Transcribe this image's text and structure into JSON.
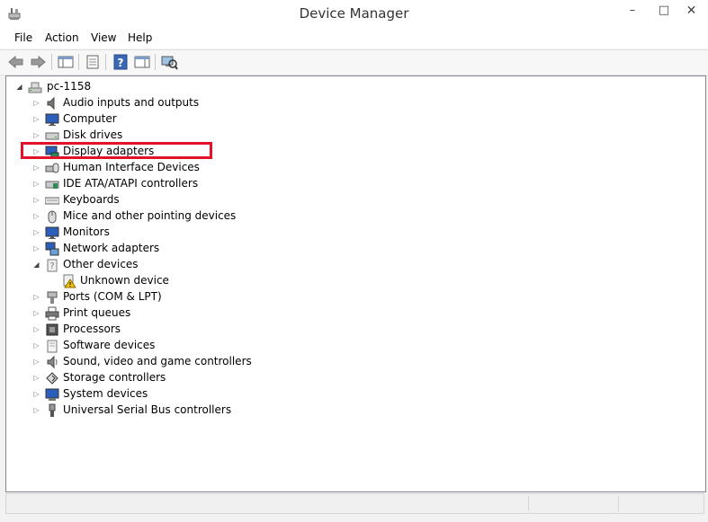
{
  "window": {
    "title": "Device Manager",
    "minimize_glyph": "–",
    "maximize_glyph": "□",
    "close_glyph": "✕"
  },
  "menu": {
    "items": [
      {
        "label": "File"
      },
      {
        "label": "Action"
      },
      {
        "label": "View"
      },
      {
        "label": "Help"
      }
    ]
  },
  "toolbar": {
    "buttons": [
      {
        "icon": "back-arrow-icon"
      },
      {
        "icon": "forward-arrow-icon"
      },
      {
        "icon": "show-hide-console-tree-icon"
      },
      {
        "icon": "properties-icon"
      },
      {
        "icon": "help-icon"
      },
      {
        "icon": "show-hide-action-pane-icon"
      },
      {
        "icon": "scan-hardware-changes-icon"
      }
    ]
  },
  "tree": {
    "root": {
      "label": "pc-1158",
      "expanded": true,
      "icon": "computer-icon"
    },
    "items": [
      {
        "label": "Audio inputs and outputs",
        "icon": "speaker-icon"
      },
      {
        "label": "Computer",
        "icon": "monitor-icon"
      },
      {
        "label": "Disk drives",
        "icon": "disk-drive-icon"
      },
      {
        "label": "Display adapters",
        "icon": "display-adapter-icon",
        "highlighted": true
      },
      {
        "label": "Human Interface Devices",
        "icon": "hid-icon"
      },
      {
        "label": "IDE ATA/ATAPI controllers",
        "icon": "ide-controller-icon"
      },
      {
        "label": "Keyboards",
        "icon": "keyboard-icon"
      },
      {
        "label": "Mice and other pointing devices",
        "icon": "mouse-icon"
      },
      {
        "label": "Monitors",
        "icon": "monitor-icon"
      },
      {
        "label": "Network adapters",
        "icon": "network-adapter-icon"
      },
      {
        "label": "Other devices",
        "icon": "other-devices-icon",
        "expanded": true
      },
      {
        "label": "Unknown device",
        "icon": "unknown-device-warning-icon",
        "child": true
      },
      {
        "label": "Ports (COM & LPT)",
        "icon": "port-icon"
      },
      {
        "label": "Print queues",
        "icon": "printer-icon"
      },
      {
        "label": "Processors",
        "icon": "processor-icon"
      },
      {
        "label": "Software devices",
        "icon": "software-device-icon"
      },
      {
        "label": "Sound, video and game controllers",
        "icon": "sound-icon"
      },
      {
        "label": "Storage controllers",
        "icon": "storage-controller-icon"
      },
      {
        "label": "System devices",
        "icon": "system-devices-icon"
      },
      {
        "label": "Universal Serial Bus controllers",
        "icon": "usb-icon"
      }
    ]
  },
  "colors": {
    "highlight_border": "#e3122b",
    "panel_border": "#828790",
    "window_bg": "#f2f2f2"
  }
}
